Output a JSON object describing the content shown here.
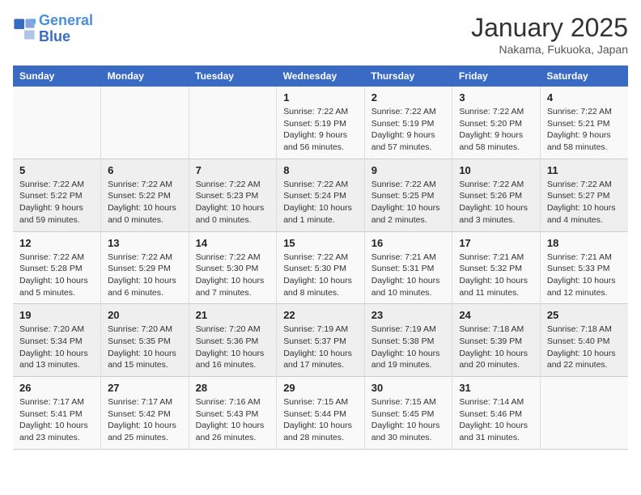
{
  "header": {
    "logo_line1": "General",
    "logo_line2": "Blue",
    "month": "January 2025",
    "location": "Nakama, Fukuoka, Japan"
  },
  "weekdays": [
    "Sunday",
    "Monday",
    "Tuesday",
    "Wednesday",
    "Thursday",
    "Friday",
    "Saturday"
  ],
  "weeks": [
    [
      {
        "day": "",
        "info": ""
      },
      {
        "day": "",
        "info": ""
      },
      {
        "day": "",
        "info": ""
      },
      {
        "day": "1",
        "info": "Sunrise: 7:22 AM\nSunset: 5:19 PM\nDaylight: 9 hours and 56 minutes."
      },
      {
        "day": "2",
        "info": "Sunrise: 7:22 AM\nSunset: 5:19 PM\nDaylight: 9 hours and 57 minutes."
      },
      {
        "day": "3",
        "info": "Sunrise: 7:22 AM\nSunset: 5:20 PM\nDaylight: 9 hours and 58 minutes."
      },
      {
        "day": "4",
        "info": "Sunrise: 7:22 AM\nSunset: 5:21 PM\nDaylight: 9 hours and 58 minutes."
      }
    ],
    [
      {
        "day": "5",
        "info": "Sunrise: 7:22 AM\nSunset: 5:22 PM\nDaylight: 9 hours and 59 minutes."
      },
      {
        "day": "6",
        "info": "Sunrise: 7:22 AM\nSunset: 5:22 PM\nDaylight: 10 hours and 0 minutes."
      },
      {
        "day": "7",
        "info": "Sunrise: 7:22 AM\nSunset: 5:23 PM\nDaylight: 10 hours and 0 minutes."
      },
      {
        "day": "8",
        "info": "Sunrise: 7:22 AM\nSunset: 5:24 PM\nDaylight: 10 hours and 1 minute."
      },
      {
        "day": "9",
        "info": "Sunrise: 7:22 AM\nSunset: 5:25 PM\nDaylight: 10 hours and 2 minutes."
      },
      {
        "day": "10",
        "info": "Sunrise: 7:22 AM\nSunset: 5:26 PM\nDaylight: 10 hours and 3 minutes."
      },
      {
        "day": "11",
        "info": "Sunrise: 7:22 AM\nSunset: 5:27 PM\nDaylight: 10 hours and 4 minutes."
      }
    ],
    [
      {
        "day": "12",
        "info": "Sunrise: 7:22 AM\nSunset: 5:28 PM\nDaylight: 10 hours and 5 minutes."
      },
      {
        "day": "13",
        "info": "Sunrise: 7:22 AM\nSunset: 5:29 PM\nDaylight: 10 hours and 6 minutes."
      },
      {
        "day": "14",
        "info": "Sunrise: 7:22 AM\nSunset: 5:30 PM\nDaylight: 10 hours and 7 minutes."
      },
      {
        "day": "15",
        "info": "Sunrise: 7:22 AM\nSunset: 5:30 PM\nDaylight: 10 hours and 8 minutes."
      },
      {
        "day": "16",
        "info": "Sunrise: 7:21 AM\nSunset: 5:31 PM\nDaylight: 10 hours and 10 minutes."
      },
      {
        "day": "17",
        "info": "Sunrise: 7:21 AM\nSunset: 5:32 PM\nDaylight: 10 hours and 11 minutes."
      },
      {
        "day": "18",
        "info": "Sunrise: 7:21 AM\nSunset: 5:33 PM\nDaylight: 10 hours and 12 minutes."
      }
    ],
    [
      {
        "day": "19",
        "info": "Sunrise: 7:20 AM\nSunset: 5:34 PM\nDaylight: 10 hours and 13 minutes."
      },
      {
        "day": "20",
        "info": "Sunrise: 7:20 AM\nSunset: 5:35 PM\nDaylight: 10 hours and 15 minutes."
      },
      {
        "day": "21",
        "info": "Sunrise: 7:20 AM\nSunset: 5:36 PM\nDaylight: 10 hours and 16 minutes."
      },
      {
        "day": "22",
        "info": "Sunrise: 7:19 AM\nSunset: 5:37 PM\nDaylight: 10 hours and 17 minutes."
      },
      {
        "day": "23",
        "info": "Sunrise: 7:19 AM\nSunset: 5:38 PM\nDaylight: 10 hours and 19 minutes."
      },
      {
        "day": "24",
        "info": "Sunrise: 7:18 AM\nSunset: 5:39 PM\nDaylight: 10 hours and 20 minutes."
      },
      {
        "day": "25",
        "info": "Sunrise: 7:18 AM\nSunset: 5:40 PM\nDaylight: 10 hours and 22 minutes."
      }
    ],
    [
      {
        "day": "26",
        "info": "Sunrise: 7:17 AM\nSunset: 5:41 PM\nDaylight: 10 hours and 23 minutes."
      },
      {
        "day": "27",
        "info": "Sunrise: 7:17 AM\nSunset: 5:42 PM\nDaylight: 10 hours and 25 minutes."
      },
      {
        "day": "28",
        "info": "Sunrise: 7:16 AM\nSunset: 5:43 PM\nDaylight: 10 hours and 26 minutes."
      },
      {
        "day": "29",
        "info": "Sunrise: 7:15 AM\nSunset: 5:44 PM\nDaylight: 10 hours and 28 minutes."
      },
      {
        "day": "30",
        "info": "Sunrise: 7:15 AM\nSunset: 5:45 PM\nDaylight: 10 hours and 30 minutes."
      },
      {
        "day": "31",
        "info": "Sunrise: 7:14 AM\nSunset: 5:46 PM\nDaylight: 10 hours and 31 minutes."
      },
      {
        "day": "",
        "info": ""
      }
    ]
  ]
}
